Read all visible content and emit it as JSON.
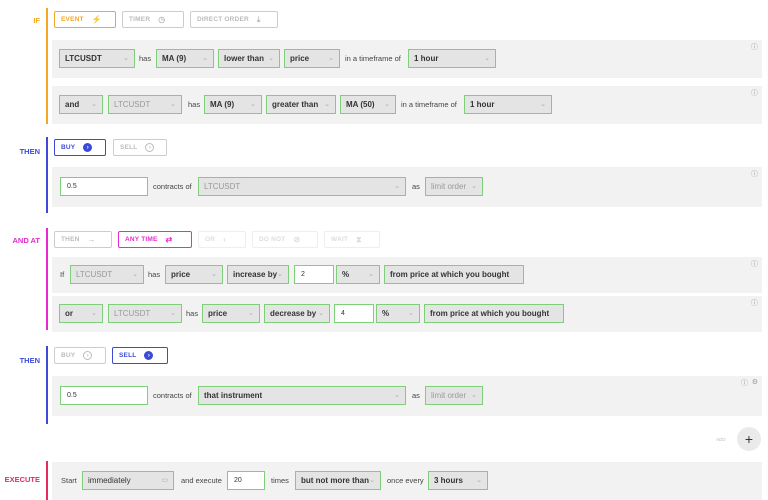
{
  "colors": {
    "if": "#f5a623",
    "then": "#3b4bd8",
    "and_at": "#e62ad0",
    "execute": "#e62a5a",
    "accent_green": "#7fcf7a"
  },
  "if_section": {
    "label": "IF",
    "tabs": [
      {
        "label": "EVENT",
        "icon": "lightning-icon",
        "active": true
      },
      {
        "label": "TIMER",
        "icon": "clock-icon",
        "active": false
      },
      {
        "label": "DIRECT ORDER",
        "icon": "download-icon",
        "active": false
      }
    ],
    "row1": {
      "symbol": "LTCUSDT",
      "has": "has",
      "indicator": "MA (9)",
      "comparison": "lower than",
      "target": "price",
      "timeframe_text": "in a timeframe of",
      "timeframe": "1 hour"
    },
    "row2": {
      "connector": "and",
      "symbol": "LTCUSDT",
      "has": "has",
      "indicator": "MA (9)",
      "comparison": "greater than",
      "target": "MA (50)",
      "timeframe_text": "in a timeframe of",
      "timeframe": "1 hour"
    }
  },
  "then1": {
    "label": "THEN",
    "tabs": [
      {
        "label": "BUY",
        "active": true
      },
      {
        "label": "SELL",
        "active": false
      }
    ],
    "row": {
      "amount": "0.5",
      "contracts_of": "contracts of",
      "instrument": "LTCUSDT",
      "as": "as",
      "order_type": "limit order"
    }
  },
  "and_at": {
    "label": "AND AT",
    "tabs": [
      {
        "label": "THEN",
        "active": false
      },
      {
        "label": "ANY TIME",
        "active": true
      },
      {
        "label": "OR",
        "active": false
      },
      {
        "label": "DO NOT",
        "active": false
      },
      {
        "label": "WAIT",
        "active": false
      }
    ],
    "row1": {
      "prefix": "If",
      "symbol": "LTCUSDT",
      "has": "has",
      "target": "price",
      "change": "increase by",
      "value": "2",
      "unit": "%",
      "reference": "from price at which you bought"
    },
    "row2": {
      "connector": "or",
      "symbol": "LTCUSDT",
      "has": "has",
      "target": "price",
      "change": "decrease by",
      "value": "4",
      "unit": "%",
      "reference": "from price at which you bought"
    }
  },
  "then2": {
    "label": "THEN",
    "tabs": [
      {
        "label": "BUY",
        "active": false
      },
      {
        "label": "SELL",
        "active": true
      }
    ],
    "row": {
      "amount": "0.5",
      "contracts_of": "contracts of",
      "instrument": "that instrument",
      "as": "as",
      "order_type": "limit order"
    },
    "add_label": "ADD"
  },
  "execute": {
    "label": "EXECUTE",
    "start_text": "Start",
    "start_value": "immediately",
    "and_execute_text": "and execute",
    "times_value": "20",
    "times_text": "times",
    "limit_value": "but not more than",
    "once_every_text": "once every",
    "interval": "3 hours"
  }
}
